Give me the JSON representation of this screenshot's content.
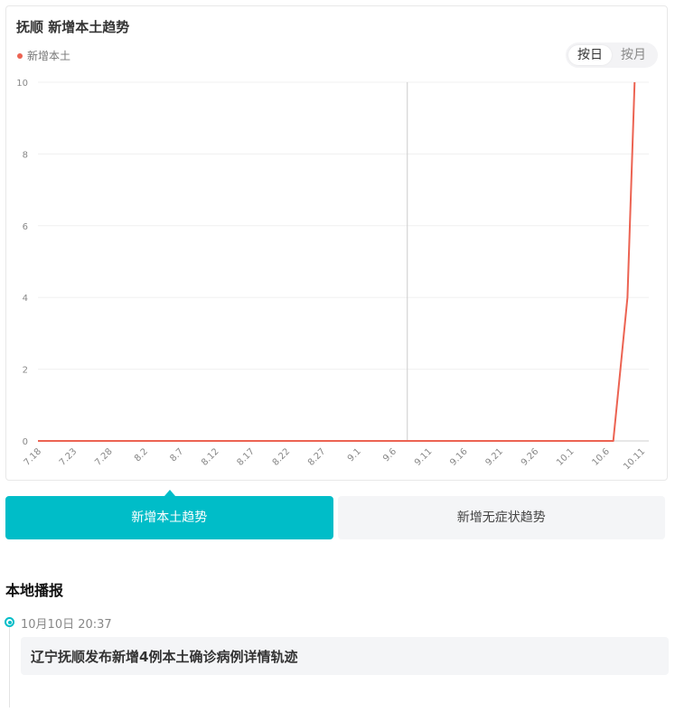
{
  "card": {
    "title": "抚顺 新增本土趋势",
    "legend_label": "新增本土",
    "toggle": {
      "day_label": "按日",
      "month_label": "按月",
      "active": "day"
    }
  },
  "chart_data": {
    "type": "line",
    "title": "",
    "xlabel": "",
    "ylabel": "",
    "ylim": [
      0,
      10
    ],
    "yticks": [
      0,
      2,
      4,
      6,
      8,
      10
    ],
    "xtick_labels": [
      "7.18",
      "7.23",
      "7.28",
      "8.2",
      "8.7",
      "8.12",
      "8.17",
      "8.22",
      "8.27",
      "9.1",
      "9.6",
      "9.11",
      "9.16",
      "9.21",
      "9.26",
      "10.1",
      "10.6",
      "10.11"
    ],
    "x": [
      "7.18",
      "10.6",
      "10.7",
      "10.8",
      "10.9",
      "10.10"
    ],
    "series": [
      {
        "values": [
          0,
          0,
          0,
          2,
          4,
          10
        ],
        "color": "#ec6352"
      }
    ],
    "cursor_line_at": "9.8",
    "grid": true
  },
  "tabs": [
    {
      "label": "新增本土趋势",
      "active": true
    },
    {
      "label": "新增无症状趋势",
      "active": false
    }
  ],
  "section": {
    "title": "本地播报"
  },
  "news": [
    {
      "time": "10月10日  20:37",
      "title": "辽宁抚顺发布新增4例本土确诊病例详情轨迹"
    }
  ],
  "colors": {
    "accent": "#00bdc8",
    "series": "#ec6352"
  }
}
